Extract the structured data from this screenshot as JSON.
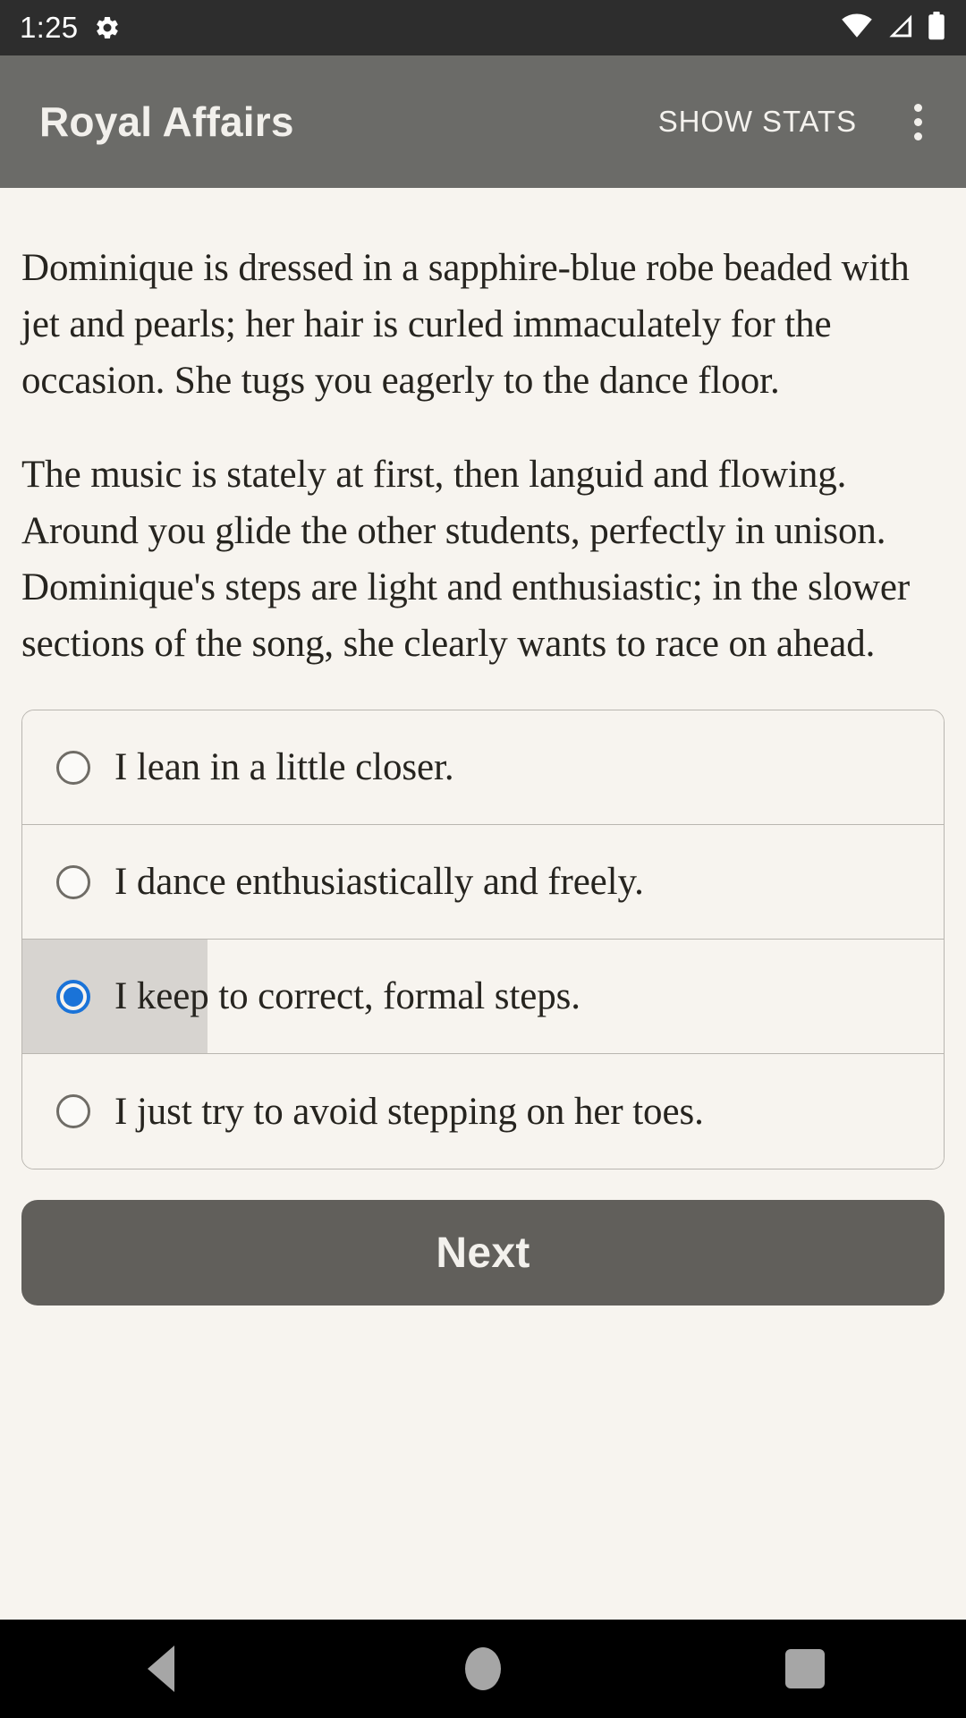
{
  "status_bar": {
    "clock": "1:25",
    "icons": {
      "settings": "gear-icon",
      "wifi": "wifi-icon",
      "signal": "cell-signal-icon",
      "battery": "battery-full-icon"
    }
  },
  "app_bar": {
    "title": "Royal Affairs",
    "show_stats_label": "SHOW STATS",
    "overflow_label": "overflow-menu"
  },
  "story": {
    "paragraphs": [
      "Dominique is dressed in a sapphire-blue robe beaded with jet and pearls; her hair is curled immaculately for the occasion. She tugs you eagerly to the dance floor.",
      "The music is stately at first, then languid and flowing. Around you glide the other students, perfectly in unison. Dominique's steps are light and enthusiastic; in the slower sections of the song, she clearly wants to race on ahead."
    ]
  },
  "choices": {
    "selected_index": 2,
    "options": [
      {
        "label": "I lean in a little closer.",
        "selected": false
      },
      {
        "label": "I dance enthusiastically and freely.",
        "selected": false
      },
      {
        "label": "I keep to correct, formal steps.",
        "selected": true
      },
      {
        "label": "I just try to avoid stepping on her toes.",
        "selected": false
      }
    ]
  },
  "next_button": {
    "label": "Next"
  },
  "nav_bar": {
    "back": "back-icon",
    "home": "home-icon",
    "recents": "recents-icon"
  },
  "colors": {
    "page_background": "#f7f4ef",
    "status_bar": "#2d2d2d",
    "app_bar": "#6b6b68",
    "text": "#26241f",
    "accent_selected": "#1a73d8",
    "row_highlight": "#d7d4d0",
    "button": "#615f5b",
    "border": "#b9b6b0",
    "nav_bar": "#000000"
  }
}
